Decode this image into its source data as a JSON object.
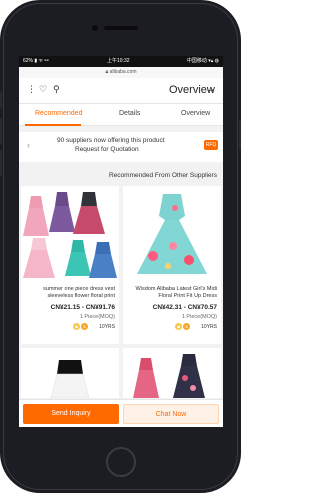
{
  "status_bar": {
    "left": "62% ▮ ᯤ ⚯",
    "time": "上午10:32",
    "right": "中国移动 ▾▴ ◍"
  },
  "url": "alibaba.com",
  "header": {
    "title": "Overview",
    "back_icon": "arrow-left-icon",
    "icons": [
      "search-icon",
      "heart-icon",
      "more-icon"
    ]
  },
  "tabs": [
    {
      "label": "Overview"
    },
    {
      "label": "Details"
    },
    {
      "label": "Recommended"
    }
  ],
  "rfq": {
    "badge": "RFQ",
    "line1": "90 suppliers now offering this product",
    "line2": "Request for Quotation"
  },
  "section_title": "Recommended From Other Suppliers",
  "products": [
    {
      "name": "Wisdom Alibaba Latest Girl's Midi Floral Print Fit Up Dress",
      "price": "CN¥42.31 - CN¥70.57",
      "moq": "1 Piece(MOQ)",
      "years": "10YRS"
    },
    {
      "name": "summer one piece dress vest sleeveless flower floral print",
      "price": "CN¥21.15 - CN¥91.76",
      "moq": "1 Piece(MOQ)",
      "years": "10YRS"
    }
  ],
  "actions": {
    "inquiry": "Send Inquiry",
    "chat": "Chat Now"
  },
  "colors": {
    "accent": "#ff6a00",
    "phone": "#1c1d22"
  }
}
